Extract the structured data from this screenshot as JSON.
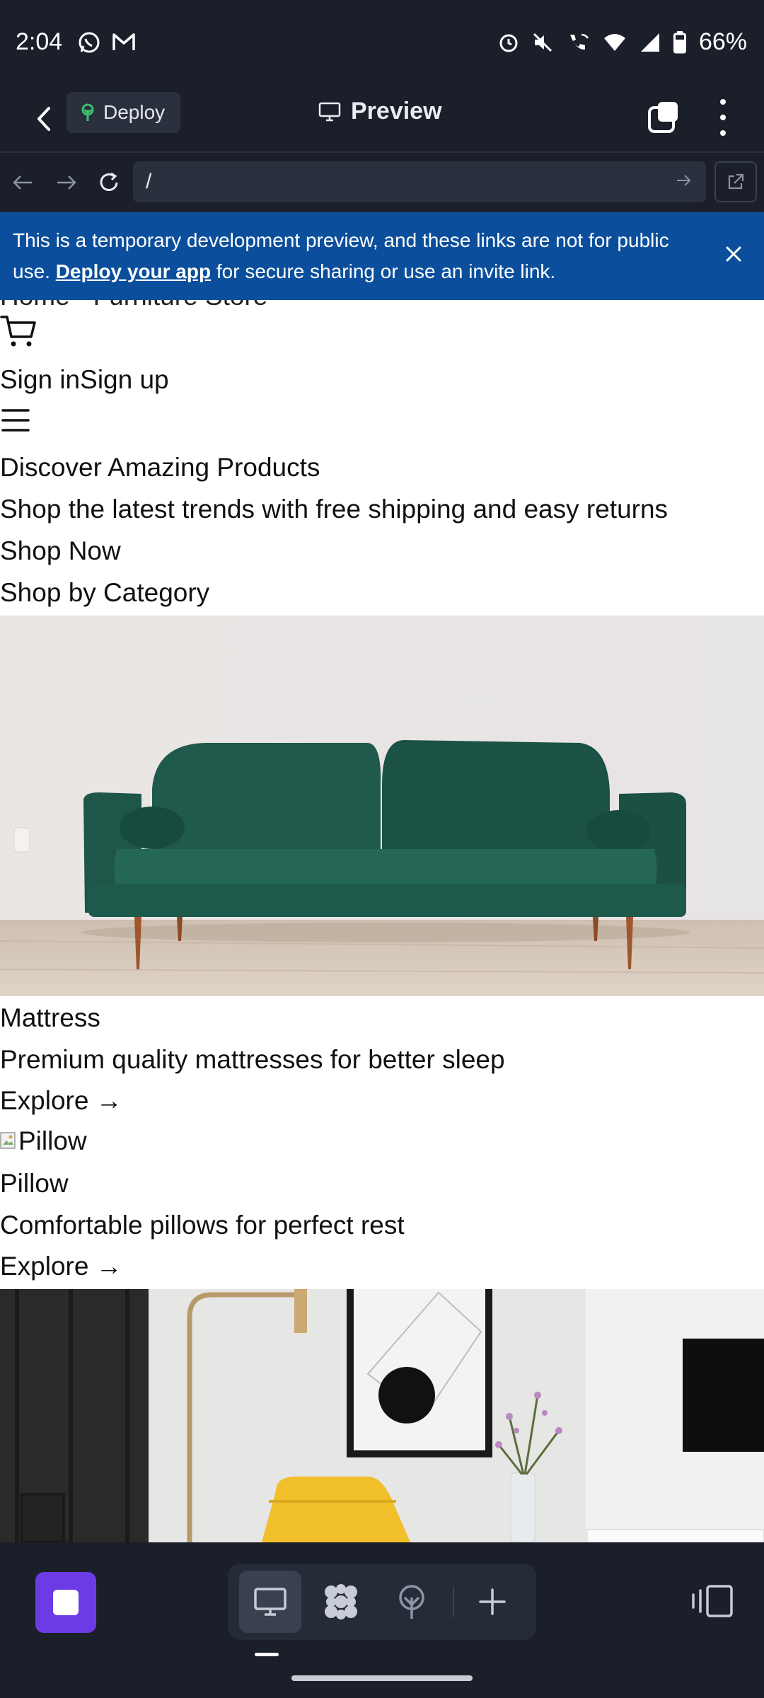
{
  "status_bar": {
    "time": "2:04",
    "battery": "66%",
    "icons": [
      "whatsapp-icon",
      "gmail-icon",
      "alarm-icon",
      "mute-icon",
      "wifi-call-icon",
      "wifi-icon",
      "signal-icon",
      "battery-icon"
    ]
  },
  "app_bar": {
    "deploy_label": "Deploy",
    "title": "Preview"
  },
  "url_bar": {
    "url": "/"
  },
  "banner": {
    "text_before": "This is a temporary development preview, and these links are not for public use. ",
    "link_text": "Deploy your app",
    "text_after": " for secure sharing or use an invite link."
  },
  "page": {
    "cut_off_heading": "Home · Furniture Store",
    "sign_in": "Sign in",
    "sign_up": "Sign up",
    "hero_title": "Discover Amazing Products",
    "hero_subtitle": "Shop the latest trends with free shipping and easy returns",
    "cta": "Shop Now",
    "section_title": "Shop by Category",
    "categories": [
      {
        "name": "Mattress",
        "description": "Premium quality mattresses for better sleep",
        "link": "Explore →"
      },
      {
        "name": "Pillow",
        "image_alt": "Pillow",
        "description": "Comfortable pillows for perfect rest",
        "link": "Explore →"
      }
    ]
  },
  "colors": {
    "chrome_bg": "#1b1f2a",
    "banner_bg": "#0b4f9c",
    "accent_purple": "#6c3be6"
  }
}
